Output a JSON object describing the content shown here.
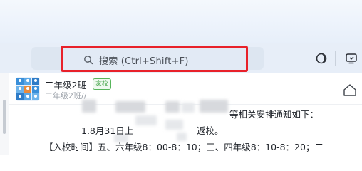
{
  "search": {
    "placeholder_text": "搜索 (Ctrl+Shift+F)"
  },
  "chat": {
    "group_name": "二年级2班",
    "group_badge": "家校",
    "group_sub": "二年级2班//"
  },
  "messages": {
    "line1_tail": "等相关安排通知如下：",
    "line2_head": "1.8月31日上",
    "line2_tail": "返校。",
    "line3": "【入校时间】五、六年级8：00-8：10；三、四年级8：10-8：20；二"
  },
  "colors": {
    "highlight_border": "#e8212a",
    "badge_green": "#57b55b",
    "toolbar_bg": "#e7eef8"
  }
}
